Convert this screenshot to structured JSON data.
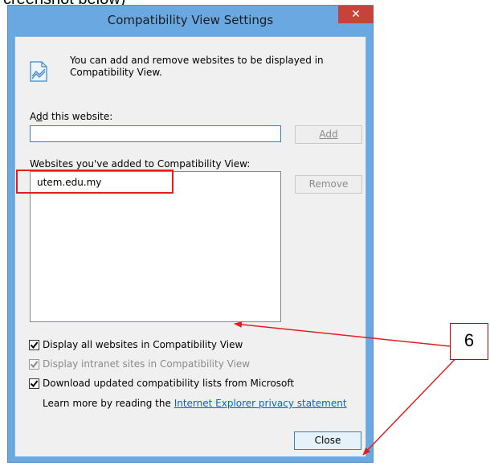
{
  "page_caption": "creenshot below)",
  "dialog": {
    "title": "Compatibility View Settings",
    "close_glyph": "✕",
    "info_text": "You can add and remove websites to be displayed in Compatibility View.",
    "add_label": "Add this website:",
    "add_input_value": "",
    "add_button": "Add",
    "list_label": "Websites you've added to Compatibility View:",
    "sites": [
      "utem.edu.my"
    ],
    "remove_button": "Remove",
    "options": [
      {
        "label": "Display all websites in Compatibility View",
        "checked": true,
        "enabled": true
      },
      {
        "label": "Display intranet sites in Compatibility View",
        "checked": true,
        "enabled": false
      },
      {
        "label": "Download updated compatibility lists from Microsoft",
        "checked": true,
        "enabled": true
      }
    ],
    "learn_more_prefix": "Learn more by reading the ",
    "learn_more_link": "Internet Explorer privacy statement",
    "close_button": "Close"
  },
  "annotation": {
    "step_number": "6",
    "accent_color": "#e02020"
  },
  "icons": {
    "info": "compatibility-view-icon",
    "checkbox": "checkmark-icon"
  }
}
